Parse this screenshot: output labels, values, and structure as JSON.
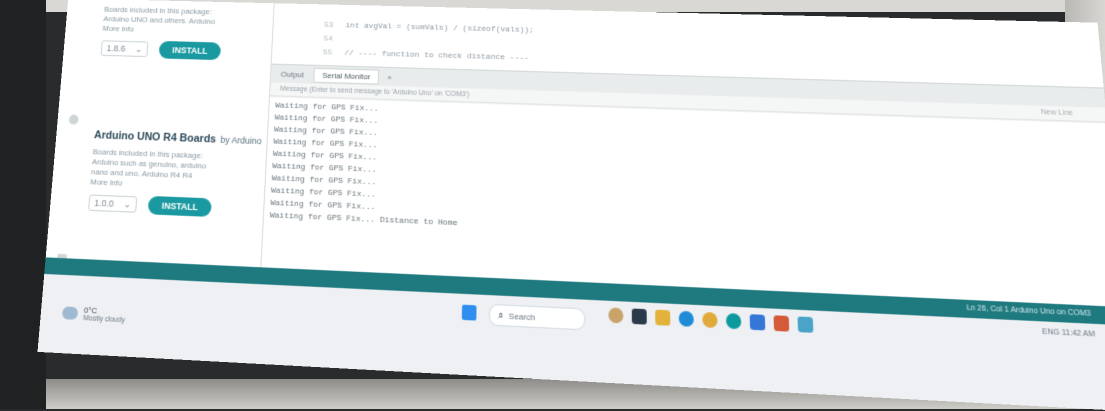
{
  "library": {
    "entries": [
      {
        "description": "Boards included in this package:\nArduino UNO and others. Arduino\nMore info",
        "version": "1.8.6",
        "install_label": "INSTALL"
      },
      {
        "title": "Arduino UNO R4 Boards",
        "author": "by Arduino",
        "description": "Boards included in this package:\nArduino such as genuino, arduino\nnano and uno. Arduino R4 R4\nMore info",
        "version": "1.0.0",
        "install_label": "INSTALL"
      }
    ]
  },
  "editor": {
    "lines": [
      {
        "number": "53",
        "text": "int avgVal = (sumVals) / (sizeof(vals));"
      },
      {
        "number": "54",
        "text": ""
      },
      {
        "number": "55",
        "text": "// ---- function to check distance ----"
      }
    ]
  },
  "output": {
    "tab_output": "Output",
    "tab_serial": "Serial Monitor",
    "close_symbol": "×",
    "message_placeholder": "Message (Enter to send message to 'Arduino Uno' on 'COM3')",
    "line_ending": "New Line",
    "serial_lines": [
      "Waiting for GPS Fix...",
      "Waiting for GPS Fix...",
      "Waiting for GPS Fix...",
      "Waiting for GPS Fix...",
      "Waiting for GPS Fix...",
      "Waiting for GPS Fix...",
      "Waiting for GPS Fix...",
      "Waiting for GPS Fix...",
      "Waiting for GPS Fix...",
      "Waiting for GPS Fix... Distance to Home"
    ]
  },
  "statusbar": {
    "text": "Ln 26, Col 1  Arduino Uno on COM3"
  },
  "taskbar": {
    "weather_temp": "0°C",
    "weather_desc": "Mostly cloudy",
    "search_placeholder": "Search",
    "tray_text": "ENG  11:42 AM"
  }
}
